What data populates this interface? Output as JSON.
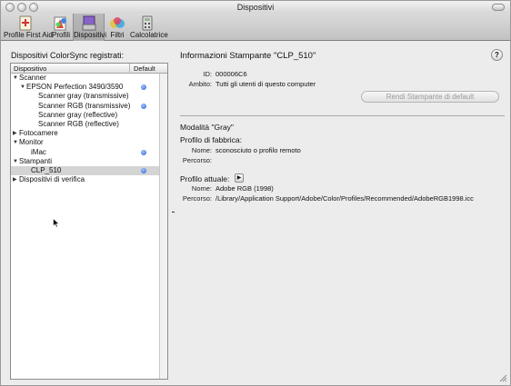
{
  "window": {
    "title": "Dispositivi"
  },
  "toolbar": {
    "items": [
      {
        "label": "Profile First Aid",
        "icon": "first-aid-icon"
      },
      {
        "label": "Profili",
        "icon": "profiles-icon"
      },
      {
        "label": "Dispositivi",
        "icon": "devices-icon",
        "selected": true
      },
      {
        "label": "Filtri",
        "icon": "filters-icon"
      },
      {
        "label": "Calcolatrice",
        "icon": "calculator-icon"
      }
    ]
  },
  "left": {
    "heading": "Dispositivi ColorSync registrati:",
    "columns": {
      "name": "Dispositivo",
      "default": "Default"
    },
    "rows": [
      {
        "label": "Scanner",
        "level": 0,
        "expanded": true,
        "default": false
      },
      {
        "label": "EPSON Perfection 3490/3590",
        "level": 1,
        "expanded": true,
        "default": true
      },
      {
        "label": "Scanner gray (transmissive)",
        "level": 2,
        "default": false
      },
      {
        "label": "Scanner RGB (transmissive)",
        "level": 2,
        "default": true
      },
      {
        "label": "Scanner gray (reflective)",
        "level": 2,
        "default": false
      },
      {
        "label": "Scanner RGB (reflective)",
        "level": 2,
        "default": false
      },
      {
        "label": "Fotocamere",
        "level": 0,
        "expanded": false,
        "default": false
      },
      {
        "label": "Monitor",
        "level": 0,
        "expanded": true,
        "default": false
      },
      {
        "label": "iMac",
        "level": 1,
        "default": true
      },
      {
        "label": "Stampanti",
        "level": 0,
        "expanded": true,
        "default": false
      },
      {
        "label": "CLP_510",
        "level": 1,
        "default": true,
        "selected": true
      },
      {
        "label": "Dispositivi di verifica",
        "level": 0,
        "expanded": false,
        "default": false
      }
    ]
  },
  "info": {
    "title": "Informazioni Stampante \"CLP_510\"",
    "id_label": "ID:",
    "id_value": "000006C6",
    "scope_label": "Ambito:",
    "scope_value": "Tutti gli utenti di questo computer",
    "make_default_button": "Rendi Stampante di default",
    "mode_title": "Modalità \"Gray\"",
    "factory_profile": {
      "heading": "Profilo di fabbrica:",
      "name_label": "Nome:",
      "name_value": "sconosciuto o profilo remoto",
      "path_label": "Percorso:",
      "path_value": ""
    },
    "current_profile": {
      "heading": "Profilo attuale:",
      "name_label": "Nome:",
      "name_value": "Adobe RGB (1998)",
      "path_label": "Percorso:",
      "path_value": "/Library/Application Support/Adobe/Color/Profiles/Recommended/AdobeRGB1998.icc"
    },
    "help_label": "?"
  },
  "colors": {
    "accent": "#2a5bd8",
    "selected_row": "#d4d4d4"
  }
}
